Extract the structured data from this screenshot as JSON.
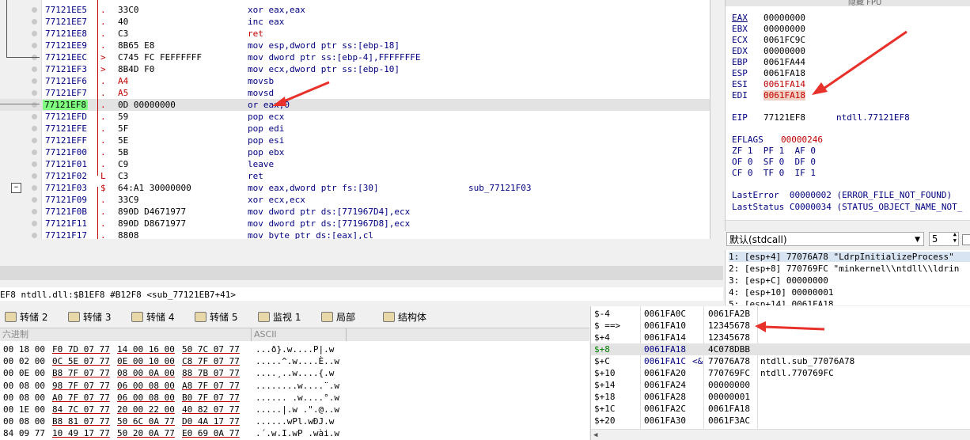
{
  "disasm": {
    "rows": [
      {
        "addr": "77121EE5",
        "mark": ".",
        "bytes": "33C0",
        "instr": "xor eax,eax",
        "bcls": ""
      },
      {
        "addr": "77121EE7",
        "mark": ".",
        "bytes": "40",
        "instr": "inc eax",
        "bcls": ""
      },
      {
        "addr": "77121EE8",
        "mark": ".",
        "bytes": "C3",
        "instr": "ret",
        "bcls": "",
        "icls": "red"
      },
      {
        "addr": "77121EE9",
        "mark": ".",
        "bytes": "8B65 E8",
        "instr": "mov esp,dword ptr ss:[ebp-18]",
        "bcls": ""
      },
      {
        "addr": "77121EEC",
        "mark": ">",
        "bytes": "C745 FC FEFFFFFF",
        "instr": "mov dword ptr ss:[ebp-4],FFFFFFFE",
        "bcls": ""
      },
      {
        "addr": "77121EF3",
        "mark": ">",
        "bytes": "8B4D F0",
        "instr": "mov ecx,dword ptr ss:[ebp-10]",
        "bcls": ""
      },
      {
        "addr": "77121EF6",
        "mark": ".",
        "bytes": "A4",
        "instr": "movsb",
        "bcls": "red"
      },
      {
        "addr": "77121EF7",
        "mark": ".",
        "bytes": "A5",
        "instr": "movsd",
        "bcls": "red"
      },
      {
        "addr": "77121EF8",
        "mark": ".",
        "bytes": "0D 00000000",
        "instr": "or eax,0",
        "bcls": "",
        "eip": true
      },
      {
        "addr": "77121EFD",
        "mark": ".",
        "bytes": "59",
        "instr": "pop ecx",
        "bcls": ""
      },
      {
        "addr": "77121EFE",
        "mark": ".",
        "bytes": "5F",
        "instr": "pop edi",
        "bcls": ""
      },
      {
        "addr": "77121EFF",
        "mark": ".",
        "bytes": "5E",
        "instr": "pop esi",
        "bcls": ""
      },
      {
        "addr": "77121F00",
        "mark": ".",
        "bytes": "5B",
        "instr": "pop ebx",
        "bcls": ""
      },
      {
        "addr": "77121F01",
        "mark": ".",
        "bytes": "C9",
        "instr": "leave",
        "bcls": ""
      },
      {
        "addr": "77121F02",
        "mark": "L",
        "bytes": "C3",
        "instr": "ret",
        "bcls": ""
      },
      {
        "addr": "77121F03",
        "mark": "$",
        "bytes": "64:A1 30000000",
        "instr": "mov eax,dword ptr fs:[30]",
        "bcls": "",
        "cmt": "sub_77121F03"
      },
      {
        "addr": "77121F09",
        "mark": ".",
        "bytes": "33C9",
        "instr": "xor ecx,ecx",
        "bcls": ""
      },
      {
        "addr": "77121F0B",
        "mark": ".",
        "bytes": "890D D4671977",
        "instr": "mov dword ptr ds:[771967D4],ecx",
        "bcls": ""
      },
      {
        "addr": "77121F11",
        "mark": ".",
        "bytes": "890D D8671977",
        "instr": "mov dword ptr ds:[771967D8],ecx",
        "bcls": ""
      },
      {
        "addr": "77121F17",
        "mark": ".",
        "bytes": "8808",
        "instr": "mov byte ptr ds:[eax],cl",
        "bcls": ""
      }
    ]
  },
  "registers": {
    "header": "隐藏 FPU",
    "list": [
      {
        "name": "EAX",
        "value": "00000000",
        "red": false
      },
      {
        "name": "EBX",
        "value": "00000000",
        "red": false
      },
      {
        "name": "ECX",
        "value": "0061FC9C",
        "red": false
      },
      {
        "name": "EDX",
        "value": "00000000",
        "red": false
      },
      {
        "name": "EBP",
        "value": "0061FA44",
        "red": false
      },
      {
        "name": "ESP",
        "value": "0061FA18",
        "red": false
      },
      {
        "name": "ESI",
        "value": "0061FA14",
        "red": true
      },
      {
        "name": "EDI",
        "value": "0061FA18",
        "red": true
      }
    ],
    "eip_name": "EIP",
    "eip_value": "77121EF8",
    "eip_sym": "ntdll.77121EF8",
    "eflags_name": "EFLAGS",
    "eflags_value": "00000246",
    "flags_row1": "ZF 1  PF 1  AF 0",
    "flags_row2": "OF 0  SF 0  DF 0",
    "flags_row3": "CF 0  TF 0  IF 1",
    "lasterror": "LastError  00000002 (ERROR_FILE_NOT_FOUND)",
    "laststatus": "LastStatus C0000034 (STATUS_OBJECT_NAME_NOT_"
  },
  "callconv": {
    "selected": "默认(stdcall)",
    "count": "5"
  },
  "args": [
    "1: [esp+4] 77076A78 \"LdrpInitializeProcess\"",
    "2: [esp+8] 770769FC \"minkernel\\\\ntdll\\\\ldrin",
    "3: [esp+C] 00000000",
    "4: [esp+10] 00000001",
    "5: [esp+14] 0061FA18"
  ],
  "statusline": "EF8 ntdll.dll:$B1EF8 #B12F8 <sub_77121EB7+41>",
  "tabs": [
    {
      "label": "转储 2"
    },
    {
      "label": "转储 3"
    },
    {
      "label": "转储 4"
    },
    {
      "label": "转储 5"
    },
    {
      "label": "监视 1"
    },
    {
      "label": "局部"
    },
    {
      "label": "结构体"
    }
  ],
  "dump": {
    "hex_header": "六进制",
    "ascii_header": "ASCII",
    "rows": [
      {
        "c": [
          "00 18 00",
          "F0 7D 07 77",
          "14 00 16 00",
          "50 7C 07 77"
        ],
        "a": "...ð}.w....P|.w"
      },
      {
        "c": [
          "00 02 00",
          "0C 5E 07 77",
          "0E 00 10 00",
          "C8 7F 07 77"
        ],
        "a": ".....^.w....È..w"
      },
      {
        "c": [
          "00 0E 00",
          "B8 7F 07 77",
          "08 00 0A 00",
          "88 7B 07 77"
        ],
        "a": "....¸..w....{.w"
      },
      {
        "c": [
          "00 08 00",
          "98 7F 07 77",
          "06 00 08 00",
          "A8 7F 07 77"
        ],
        "a": "........w....¨.w"
      },
      {
        "c": [
          "00 08 00",
          "A0 7F 07 77",
          "06 00 08 00",
          "B0 7F 07 77"
        ],
        "a": "...... .w....°.w"
      },
      {
        "c": [
          "00 1E 00",
          "84 7C 07 77",
          "20 00 22 00",
          "40 82 07 77"
        ],
        "a": ".....|.w .\".@..w"
      },
      {
        "c": [
          "00 08 00",
          "B8 81 07 77",
          "50 6C 0A 77",
          "D0 4A 17 77"
        ],
        "a": "......wPl.wÐJ.w"
      },
      {
        "c": [
          "84 09 77",
          "10 49 17 77",
          "50 20 0A 77",
          "E0 69 0A 77"
        ],
        "a": ".´.w.I.wP .wài.w"
      }
    ]
  },
  "stack": {
    "rows": [
      {
        "rel": "$-4",
        "addr": "0061FA0C",
        "val": "0061FA2B",
        "cmt": ""
      },
      {
        "rel": "$ ==>",
        "addr": "0061FA10",
        "val": "12345678",
        "cmt": ""
      },
      {
        "rel": "$+4",
        "addr": "0061FA14",
        "val": "12345678",
        "cmt": ""
      },
      {
        "rel": "$+8",
        "addr": "0061FA18",
        "val": "4C078DBB",
        "cmt": "",
        "sel": true
      },
      {
        "rel": "$+C",
        "addr": "0061FA1C",
        "val": "77076A78",
        "cmt": "ntdll.sub_77076A78",
        "extra": "<&"
      },
      {
        "rel": "$+10",
        "addr": "0061FA20",
        "val": "770769FC",
        "cmt": "ntdll.770769FC"
      },
      {
        "rel": "$+14",
        "addr": "0061FA24",
        "val": "00000000",
        "cmt": ""
      },
      {
        "rel": "$+18",
        "addr": "0061FA28",
        "val": "00000001",
        "cmt": ""
      },
      {
        "rel": "$+1C",
        "addr": "0061FA2C",
        "val": "0061FA18",
        "cmt": ""
      },
      {
        "rel": "$+20",
        "addr": "0061FA30",
        "val": "0061F3AC",
        "cmt": ""
      }
    ]
  },
  "colors": {
    "accent_red": "#e8312b",
    "eip_green": "#80ff80",
    "addr_blue": "#000080"
  }
}
